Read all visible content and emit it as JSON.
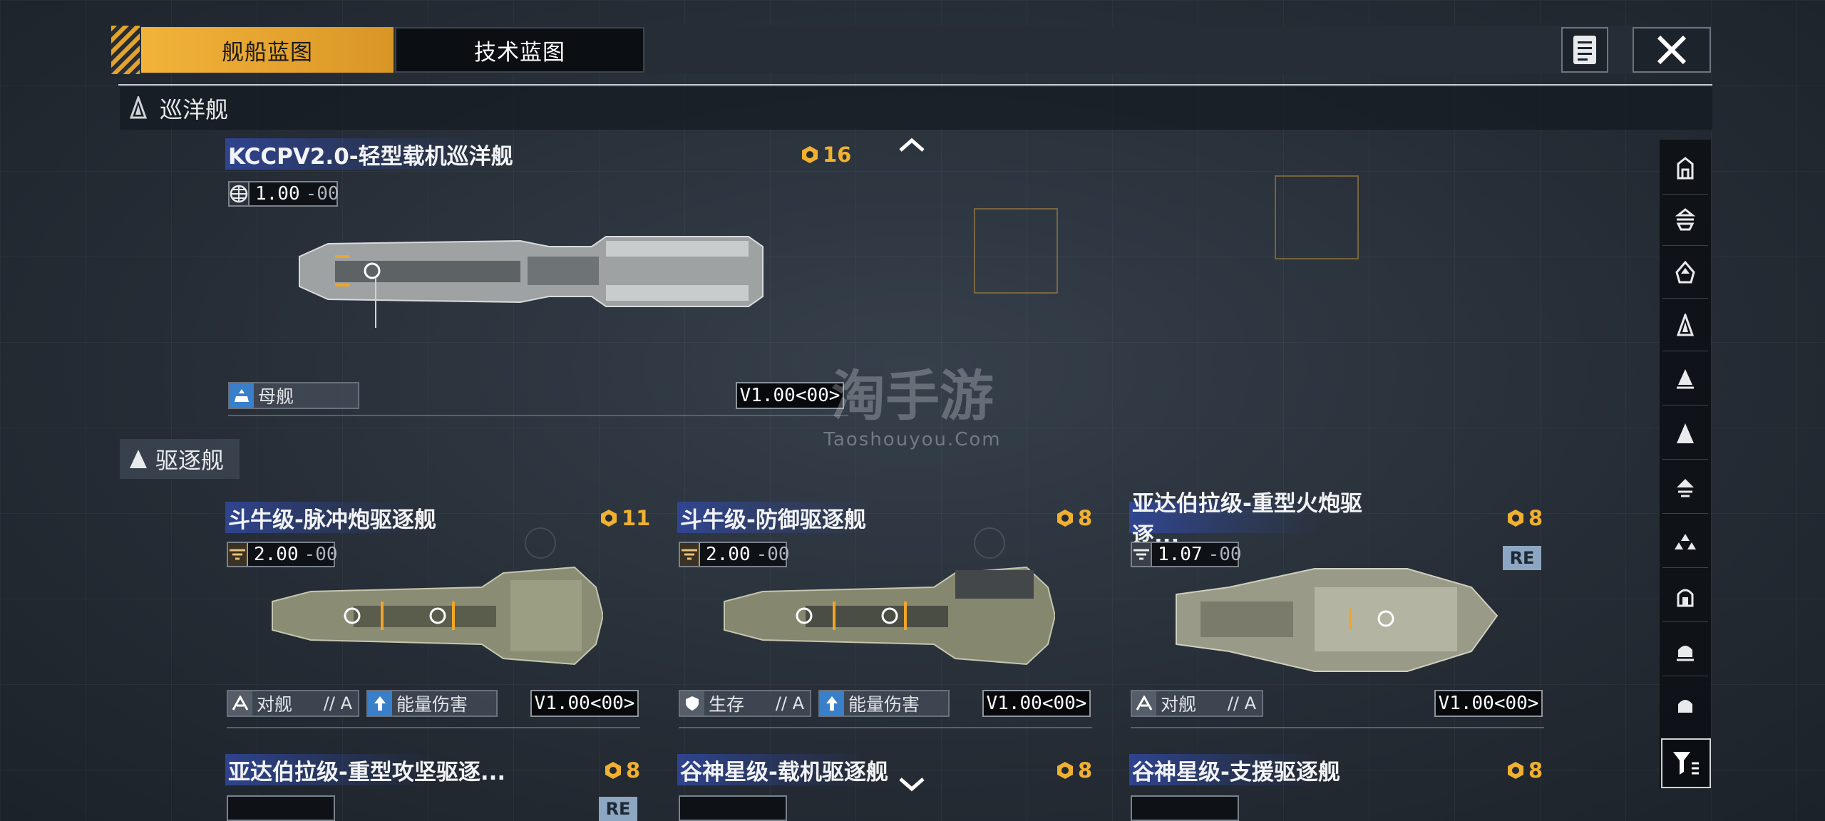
{
  "tabs": [
    {
      "label": "舰船蓝图",
      "active": true
    },
    {
      "label": "技术蓝图",
      "active": false
    }
  ],
  "sections": {
    "cruiser": "巡洋舰",
    "destroyer": "驱逐舰"
  },
  "watermark": {
    "main": "淘手游",
    "sub": "Taoshouyou.Com"
  },
  "cruiser_card": {
    "name": "KCCPV2.0-轻型载机巡洋舰",
    "cost": "16",
    "stat": "1.00",
    "stat_suffix": "-00",
    "tag": "母舰",
    "version": "V1.00<00>"
  },
  "destroyer_cards": [
    {
      "name": "斗牛级-脉冲炮驱逐舰",
      "cost": "11",
      "stat": "2.00",
      "stat_suffix": "-00",
      "role": "对舰",
      "grade": "// A",
      "tag2": "能量伤害",
      "version": "V1.00<00>"
    },
    {
      "name": "斗牛级-防御驱逐舰",
      "cost": "8",
      "stat": "2.00",
      "stat_suffix": "-00",
      "role": "生存",
      "grade": "// A",
      "tag2": "能量伤害",
      "version": "V1.00<00>"
    },
    {
      "name": "亚达伯拉级-重型火炮驱逐...",
      "cost": "8",
      "stat": "1.07",
      "stat_suffix": "-00",
      "badge": "RE",
      "role": "对舰",
      "grade": "// A",
      "version": "V1.00<00>"
    }
  ],
  "bottom_cards": [
    {
      "name": "亚达伯拉级-重型攻坚驱逐...",
      "cost": "8"
    },
    {
      "name": "谷神星级-载机驱逐舰",
      "cost": "8"
    },
    {
      "name": "谷神星级-支援驱逐舰",
      "cost": "8"
    }
  ],
  "bottom_badge": "RE",
  "colors": {
    "accent": "#f2b33a",
    "title_band": "#3148a0",
    "cost": "#f0b030"
  }
}
